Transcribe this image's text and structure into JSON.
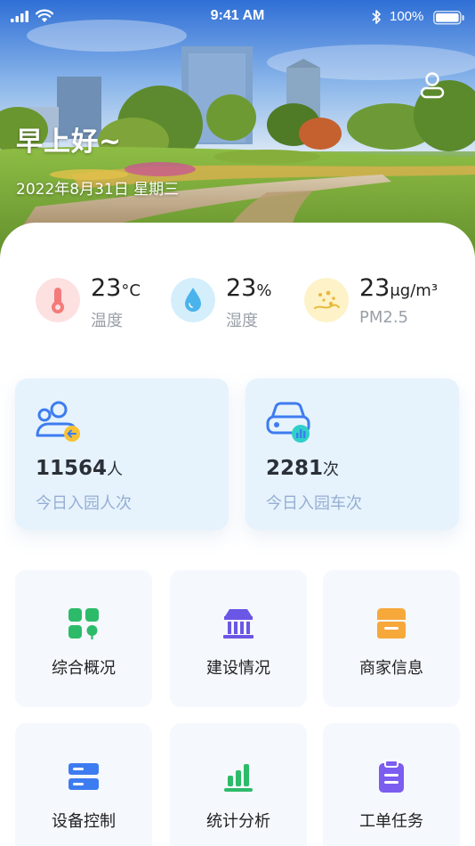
{
  "status_bar": {
    "time": "9:41 AM",
    "battery": "100%"
  },
  "header": {
    "greeting": "早上好~",
    "date": "2022年8月31日 星期三"
  },
  "weather": [
    {
      "value": "23",
      "unit": "°C",
      "label": "温度",
      "icon": "thermometer-icon",
      "color": "#f47b7b"
    },
    {
      "value": "23",
      "unit": "%",
      "label": "湿度",
      "icon": "water-drop-icon",
      "color": "#4ab3ec"
    },
    {
      "value": "23",
      "unit": "μg/m³",
      "label": "PM2.5",
      "icon": "dust-icon",
      "color": "#e8b93a"
    }
  ],
  "stats": [
    {
      "value": "11564",
      "unit": "人",
      "label": "今日入园人次",
      "icon": "visitors-icon"
    },
    {
      "value": "2281",
      "unit": "次",
      "label": "今日入园车次",
      "icon": "car-icon"
    }
  ],
  "menu": [
    {
      "label": "综合概况",
      "icon": "overview-icon",
      "color": "#2dbb6a"
    },
    {
      "label": "建设情况",
      "icon": "building-icon",
      "color": "#6a57e6"
    },
    {
      "label": "商家信息",
      "icon": "shop-icon",
      "color": "#f7a83b"
    },
    {
      "label": "设备控制",
      "icon": "device-icon",
      "color": "#3d7cf0"
    },
    {
      "label": "统计分析",
      "icon": "chart-icon",
      "color": "#2dbb6a"
    },
    {
      "label": "工单任务",
      "icon": "clipboard-icon",
      "color": "#7b5df0"
    }
  ]
}
